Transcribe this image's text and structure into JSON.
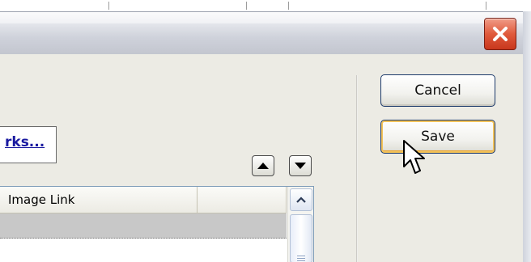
{
  "window": {
    "close_icon": "close-icon",
    "accent_close": "#d84a2f"
  },
  "toolbar": {
    "cancel_label": "Cancel",
    "save_label": "Save"
  },
  "link": {
    "text": "rks..."
  },
  "reorder": {
    "up_icon": "triangle-up-icon",
    "down_icon": "triangle-down-icon"
  },
  "table": {
    "columns": [
      "Image Link",
      ""
    ],
    "scroll_up_icon": "chevron-up-icon"
  },
  "cursor": {
    "icon": "mouse-pointer-icon"
  }
}
